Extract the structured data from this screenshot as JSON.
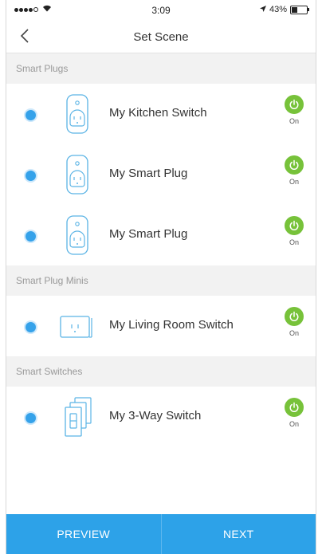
{
  "status_bar": {
    "time": "3:09",
    "battery_text": "43%",
    "battery_level": 0.43,
    "signal_bars_filled": 4,
    "signal_bars_total": 5
  },
  "header": {
    "title": "Set Scene"
  },
  "sections": [
    {
      "title": "Smart Plugs",
      "devices": [
        {
          "name": "My Kitchen Switch",
          "icon": "smart-plug-icon",
          "selected": true,
          "power_state": "On"
        },
        {
          "name": "My Smart Plug",
          "icon": "smart-plug-icon",
          "selected": true,
          "power_state": "On"
        },
        {
          "name": "My Smart Plug",
          "icon": "smart-plug-icon",
          "selected": true,
          "power_state": "On"
        }
      ]
    },
    {
      "title": "Smart Plug Minis",
      "devices": [
        {
          "name": "My Living Room Switch",
          "icon": "smart-plug-mini-icon",
          "selected": true,
          "power_state": "On"
        }
      ]
    },
    {
      "title": "Smart Switches",
      "devices": [
        {
          "name": "My 3-Way Switch",
          "icon": "light-switch-icon",
          "selected": true,
          "power_state": "On"
        }
      ]
    }
  ],
  "footer": {
    "preview_label": "PREVIEW",
    "next_label": "NEXT"
  },
  "colors": {
    "accent_blue": "#2da2e8",
    "power_green": "#77c23a",
    "section_bg": "#f2f2f2",
    "icon_line": "#5bb4e5"
  }
}
